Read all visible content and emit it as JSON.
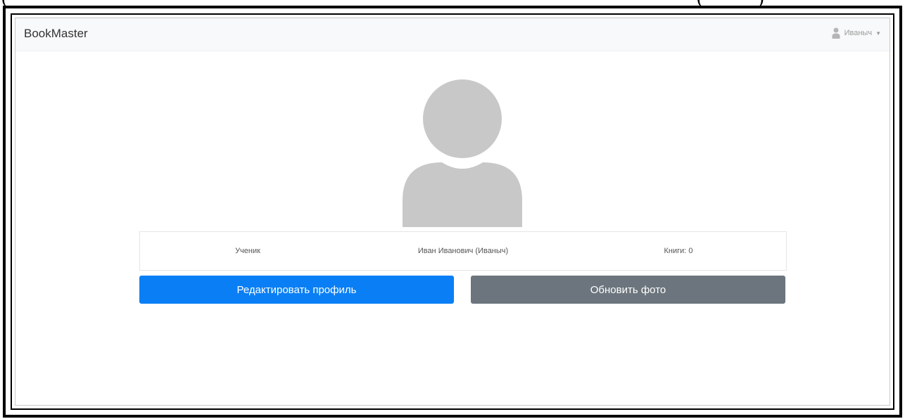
{
  "caption": {
    "left_fragment": "(",
    "right_fragment": "(           )"
  },
  "navbar": {
    "brand": "BookMaster",
    "user_name": "Иваныч",
    "caret": "▼"
  },
  "profile": {
    "role": "Ученик",
    "full_name": "Иван Иванович (Иваныч)",
    "books": "Книги: 0"
  },
  "actions": {
    "edit_profile": "Редактировать профиль",
    "update_photo": "Обновить фото"
  },
  "colors": {
    "primary": "#0a7ff5",
    "secondary": "#6c757d",
    "avatar": "#c8c8c8",
    "navbar_bg": "#f8f9fa"
  },
  "icons": {
    "user_menu": "user-icon",
    "avatar": "avatar-placeholder-icon"
  }
}
